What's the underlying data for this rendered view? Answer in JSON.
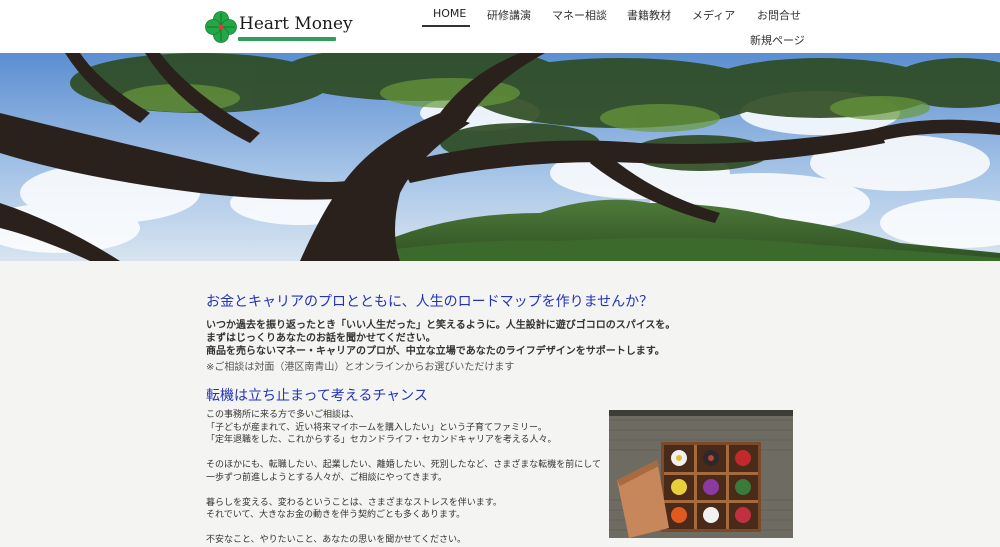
{
  "brand": {
    "name": "Heart Money"
  },
  "nav": {
    "items": [
      {
        "label": "HOME",
        "active": true
      },
      {
        "label": "研修講演"
      },
      {
        "label": "マネー相談"
      },
      {
        "label": "書籍教材"
      },
      {
        "label": "メディア"
      },
      {
        "label": "お問合せ"
      },
      {
        "label": "新規ページ"
      }
    ]
  },
  "hero": {
    "icon": "tree-sky-mountain-photo"
  },
  "intro": {
    "heading": "お金とキャリアのプロとともに、人生のロードマップを作りませんか？",
    "lines": [
      "いつか過去を振り返ったとき「いい人生だった」と笑えるように。人生設計に遊びゴコロのスパイスを。",
      "まずはじっくりあなたのお話を聞かせてください。",
      "商品を売らないマネー・キャリアのプロが、中立な立場であなたのライフデザインをサポートします。"
    ],
    "note": "※ご相談は対面（港区南青山）とオンラインからお選びいただけます"
  },
  "section2": {
    "heading": "転機は立ち止まって考えるチャンス",
    "paragraphs": [
      "この事務所に来る方で多いご相談は、",
      "「子どもが産まれて、近い将来マイホームを購入したい」という子育てファミリー。",
      "「定年退職をした、これからする」セカンドライフ・セカンドキャリアを考える人々。",
      "",
      "そのほかにも、転職したい、起業したい、離婚したい、死別したなど、さまざまな転機を前にして",
      "一歩ずつ前進しようとする人々が、ご相談にやってきます。",
      "",
      "暮らしを変える、変わるということは、さまざまなストレスを伴います。",
      "それでいて、大きなお金の動きを伴う契約ごとも多くあります。",
      "",
      "不安なこと、やりたいこと、あなたの思いを聞かせてください。"
    ],
    "photo_icon": "flower-box-photo"
  },
  "colors": {
    "heading": "#2233bb",
    "accent_green": "#2f9e5c"
  }
}
